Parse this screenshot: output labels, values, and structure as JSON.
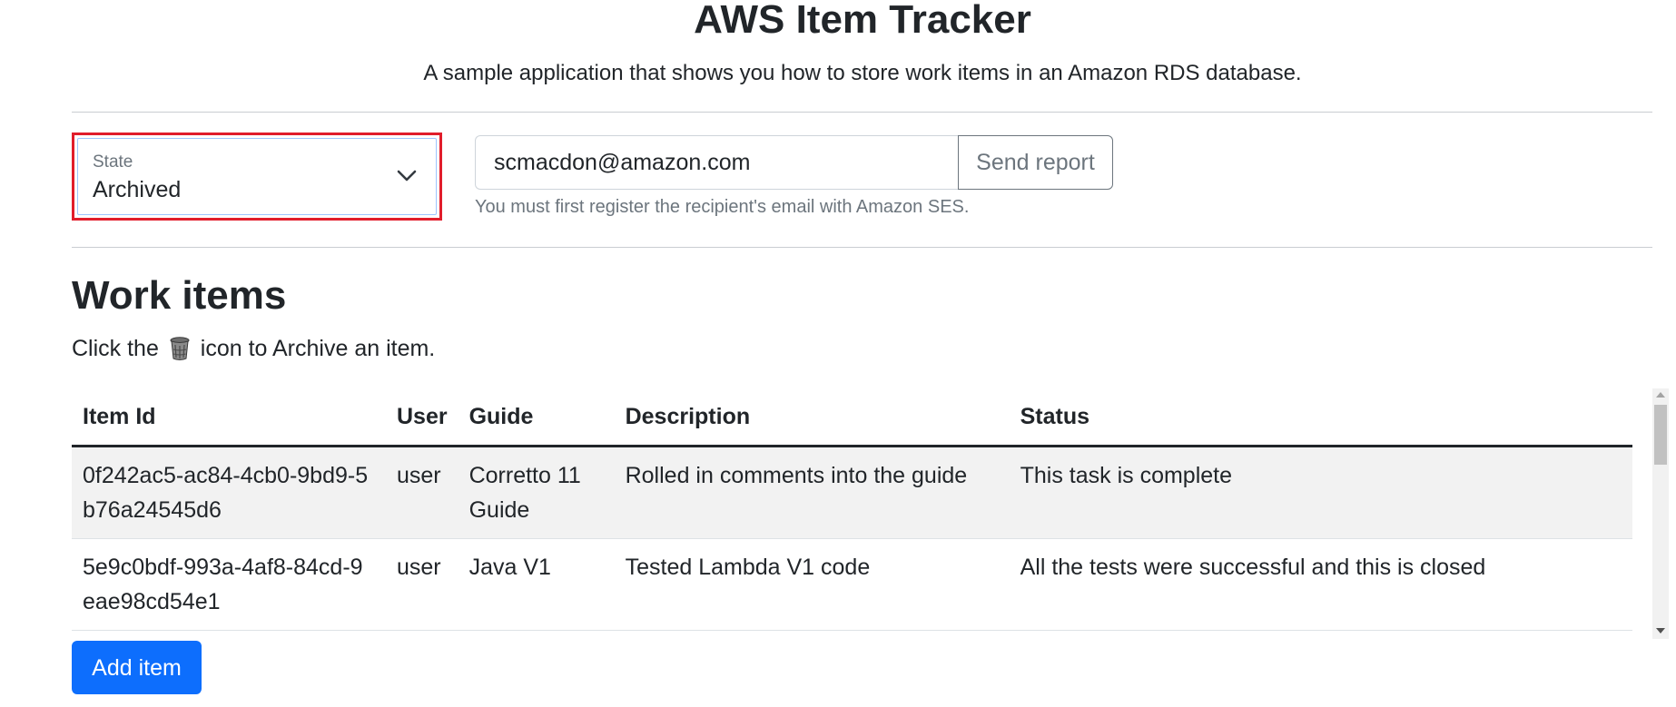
{
  "header": {
    "title": "AWS Item Tracker",
    "subtitle": "A sample application that shows you how to store work items in an Amazon RDS database."
  },
  "filter": {
    "state_label": "State",
    "state_value": "Archived",
    "chevron_icon": "chevron-down-icon"
  },
  "report": {
    "email_value": "scmacdon@amazon.com",
    "send_label": "Send report",
    "help_text": "You must first register the recipient's email with Amazon SES."
  },
  "work_items": {
    "title": "Work items",
    "instruction_prefix": "Click the",
    "instruction_icon": "trash-icon",
    "instruction_suffix": "icon to Archive an item.",
    "columns": [
      "Item Id",
      "User",
      "Guide",
      "Description",
      "Status"
    ],
    "rows": [
      {
        "id": "0f242ac5-ac84-4cb0-9bd9-5b76a24545d6",
        "user": "user",
        "guide": "Corretto 11 Guide",
        "description": "Rolled in comments into the guide",
        "status": "This task is complete"
      },
      {
        "id": "5e9c0bdf-993a-4af8-84cd-9eae98cd54e1",
        "user": "user",
        "guide": "Java V1",
        "description": "Tested Lambda V1 code",
        "status": "All the tests were successful and this is closed"
      }
    ]
  },
  "actions": {
    "add_item_label": "Add item"
  },
  "colors": {
    "primary": "#0d6efd",
    "highlight_border": "#e11d2b",
    "muted_text": "#6c757d",
    "stripe": "#f2f2f2"
  }
}
